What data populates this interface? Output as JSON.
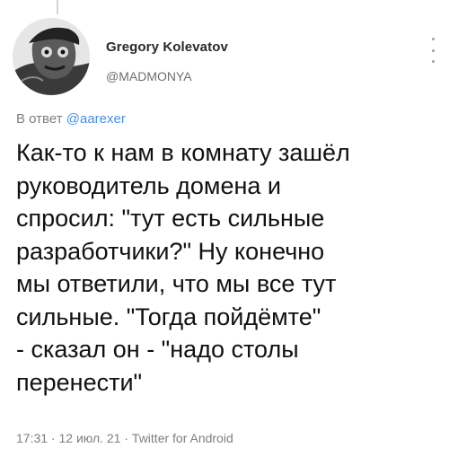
{
  "tweet": {
    "author_name": "Gregory Kolevatov",
    "author_handle": "@MADMONYA",
    "reply_prefix": "В ответ ",
    "reply_mention": "@aarexer",
    "text_lines": [
      "Как-то к нам в комнату зашёл",
      "руководитель домена и",
      "спросил: \"тут есть сильные",
      "разработчики?\" Ну конечно",
      "мы ответили, что мы все тут",
      "сильные. \"Тогда пойдёмте\"",
      "- сказал он - \"надо столы",
      "перенести\""
    ],
    "meta": "17:31 · 12 июл. 21 · Twitter for Android"
  },
  "icons": {
    "avatar": "avatar-image",
    "more": "more-vertical-icon"
  }
}
